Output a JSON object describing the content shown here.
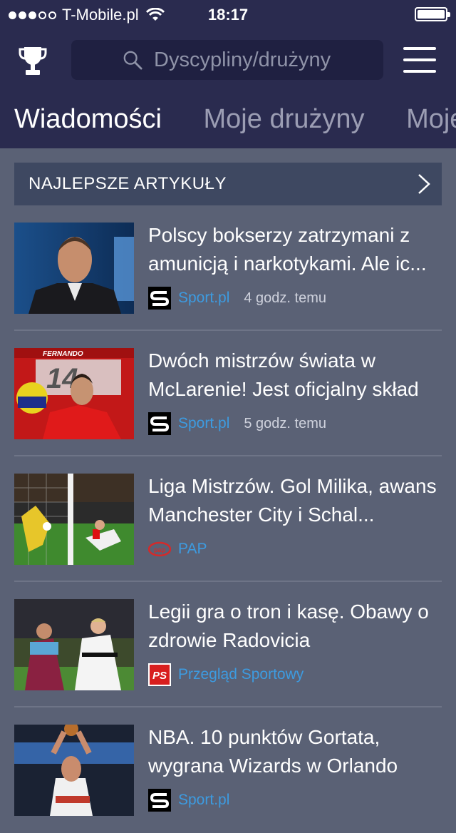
{
  "status_bar": {
    "carrier": "T-Mobile.pl",
    "time": "18:17",
    "signal_bars_filled": 3,
    "signal_bars_total": 5
  },
  "search": {
    "placeholder": "Dyscypliny/drużyny"
  },
  "tabs": [
    {
      "label": "Wiadomości",
      "active": true
    },
    {
      "label": "Moje drużyny",
      "active": false
    },
    {
      "label": "Moje",
      "active": false
    }
  ],
  "section": {
    "title": "NAJLEPSZE ARTYKUŁY"
  },
  "articles": [
    {
      "headline": "Polscy bokserzy zatrzymani z amunicją i narkotykami. Ale ic...",
      "source": "Sport.pl",
      "time": "4 godz. temu",
      "logo": "sport-pl-logo"
    },
    {
      "headline": "Dwóch mistrzów świata w McLarenie! Jest oficjalny skład",
      "source": "Sport.pl",
      "time": "5 godz. temu",
      "logo": "sport-pl-logo"
    },
    {
      "headline": "Liga Mistrzów. Gol Milika, awans Manchester City i Schal...",
      "source": "PAP",
      "time": "",
      "logo": "pap-logo"
    },
    {
      "headline": "Legii gra o tron i kasę. Obawy o zdrowie Radovicia",
      "source": "Przegląd Sportowy",
      "time": "",
      "logo": "ps-logo"
    },
    {
      "headline": "NBA. 10 punktów Gortata, wygrana Wizards w Orlando",
      "source": "Sport.pl",
      "time": "",
      "logo": "sport-pl-logo"
    }
  ],
  "thumb_text": {
    "fernando": "FERNANDO",
    "flag_14": "14"
  },
  "colors": {
    "header_bg": "#2a2b4f",
    "content_bg": "#5a6175",
    "source_link": "#3d9be0"
  }
}
